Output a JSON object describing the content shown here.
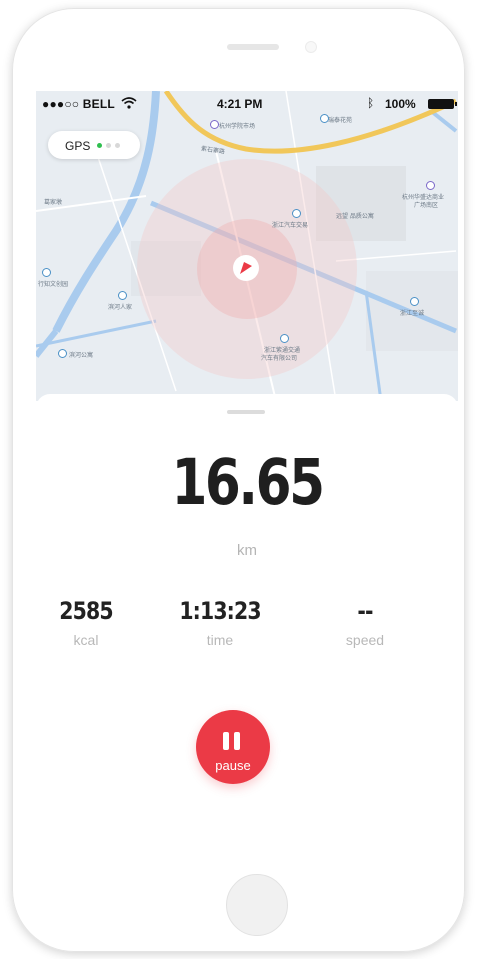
{
  "status_bar": {
    "carrier": "●●●○○ BELL",
    "time": "4:21 PM",
    "battery_percent": "100%"
  },
  "map": {
    "gps_label": "GPS",
    "gps_signal_level": 1,
    "labels": [
      "杭州学院市场",
      "瑞泰花苑",
      "紫石寨路",
      "葛家墩",
      "浙江汽车交易",
      "杭州华盛达商业",
      "广场南区",
      "远望 品质公寓",
      "行知文创园",
      "滨河人家",
      "浙江至诚",
      "浙江紫通交通",
      "汽车有限公司",
      "滨河公寓"
    ]
  },
  "workout": {
    "distance": "16.65",
    "distance_unit": "km",
    "calories_value": "2585",
    "calories_label": "kcal",
    "time_value": "1:13:23",
    "time_label": "time",
    "speed_value": "--",
    "speed_label": "speed",
    "pause_label": "pause"
  },
  "colors": {
    "accent": "#eb3a46",
    "gps_active": "#2fbf4f",
    "road_major": "#f1c75a",
    "water": "#a9cbee"
  }
}
